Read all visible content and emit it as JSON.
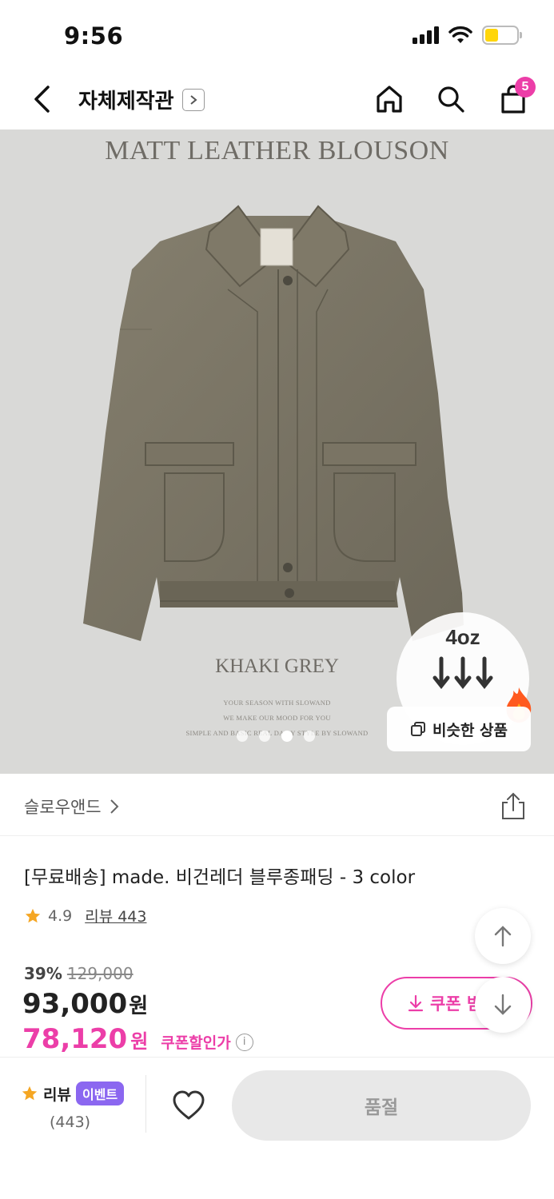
{
  "status_bar": {
    "time": "9:56"
  },
  "header": {
    "store_name": "자체제작관",
    "cart_count": "5",
    "icons": [
      "back-arrow-icon",
      "chevron-right-icon",
      "home-icon",
      "search-icon",
      "shopping-bag-icon"
    ]
  },
  "hero": {
    "title": "MATT LEATHER BLOUSON",
    "caption": "KHAKI GREY",
    "fine_print": [
      "YOUR SEASON WITH SLOWAND",
      "WE MAKE OUR MOOD FOR YOU",
      "SIMPLE AND BASIC REAL DAILY STYLE BY SLOWAND"
    ],
    "badge_weight": "4oz",
    "similar_label": "비슷한 상품",
    "slide_count": 4,
    "active_slide": 3,
    "jacket_color": "#7a7565"
  },
  "brand": {
    "name": "슬로우앤드"
  },
  "product": {
    "title": "[무료배송] made. 비건레더 블루종패딩  - 3 color",
    "rating": "4.9",
    "review_label": "리뷰 443",
    "discount_pct": "39%",
    "original_price": "129,000",
    "sale_price": "93,000",
    "currency": "원",
    "coupon_price": "78,120",
    "coupon_price_label": "쿠폰할인가",
    "coupon_button_label": "쿠폰 받"
  },
  "bottom_bar": {
    "review_label": "리뷰",
    "event_label": "이벤트",
    "review_count": "(443)",
    "soldout_label": "품절"
  },
  "colors": {
    "accent": "#ec3ea8",
    "event": "#8b67f0",
    "star": "#f5a623"
  }
}
